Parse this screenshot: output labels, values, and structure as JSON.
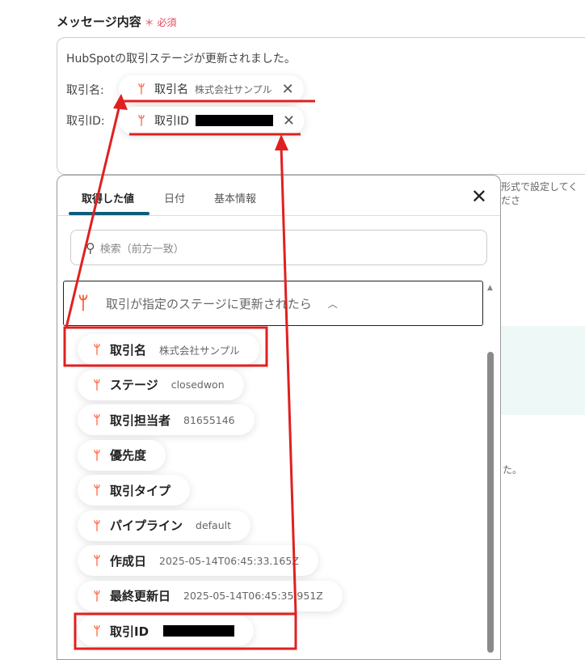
{
  "field": {
    "label": "メッセージ内容",
    "required_mark": "＊",
    "required": "必須"
  },
  "editor": {
    "first_line": "HubSpotの取引ステージが更新されました。",
    "rows": [
      {
        "label": "取引名:",
        "chip_name": "取引名",
        "chip_value": "株式会社サンプル"
      },
      {
        "label": "取引ID:",
        "chip_name": "取引ID",
        "chip_value": ""
      }
    ]
  },
  "background_text": {
    "hint": "形式で設定してくださ",
    "tail": "た。"
  },
  "panel": {
    "tabs": [
      "取得した値",
      "日付",
      "基本情報"
    ],
    "active_tab": 0,
    "close_icon": "close-icon",
    "search_placeholder": "検索（前方一致）",
    "group_title": "取引が指定のステージに更新されたら",
    "items": [
      {
        "name": "取引名",
        "value": "株式会社サンプル"
      },
      {
        "name": "ステージ",
        "value": "closedwon"
      },
      {
        "name": "取引担当者",
        "value": "81655146"
      },
      {
        "name": "優先度",
        "value": ""
      },
      {
        "name": "取引タイプ",
        "value": ""
      },
      {
        "name": "パイプライン",
        "value": "default"
      },
      {
        "name": "作成日",
        "value": "2025-05-14T06:45:33.165Z"
      },
      {
        "name": "最終更新日",
        "value": "2025-05-14T06:45:35.951Z"
      },
      {
        "name": "取引ID",
        "value": ""
      }
    ]
  },
  "colors": {
    "hubspot": "#ff5c35",
    "annotation": "#e02020",
    "tab_accent": "#0b5e78",
    "required": "#e8455a"
  }
}
